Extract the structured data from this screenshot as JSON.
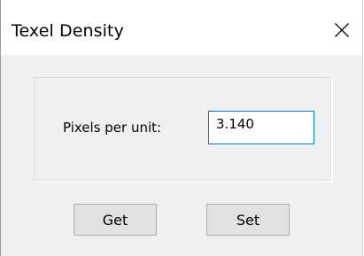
{
  "window": {
    "title": "Texel Density"
  },
  "title_bar": {
    "close_icon": "close-icon"
  },
  "form": {
    "label": "Pixels per unit:",
    "value": "3.140"
  },
  "buttons": {
    "get_label": "Get",
    "set_label": "Set"
  },
  "colors": {
    "focus_border": "#0078d7",
    "button_bg": "#e1e1e1",
    "dialog_bg": "#f0f0f0"
  }
}
